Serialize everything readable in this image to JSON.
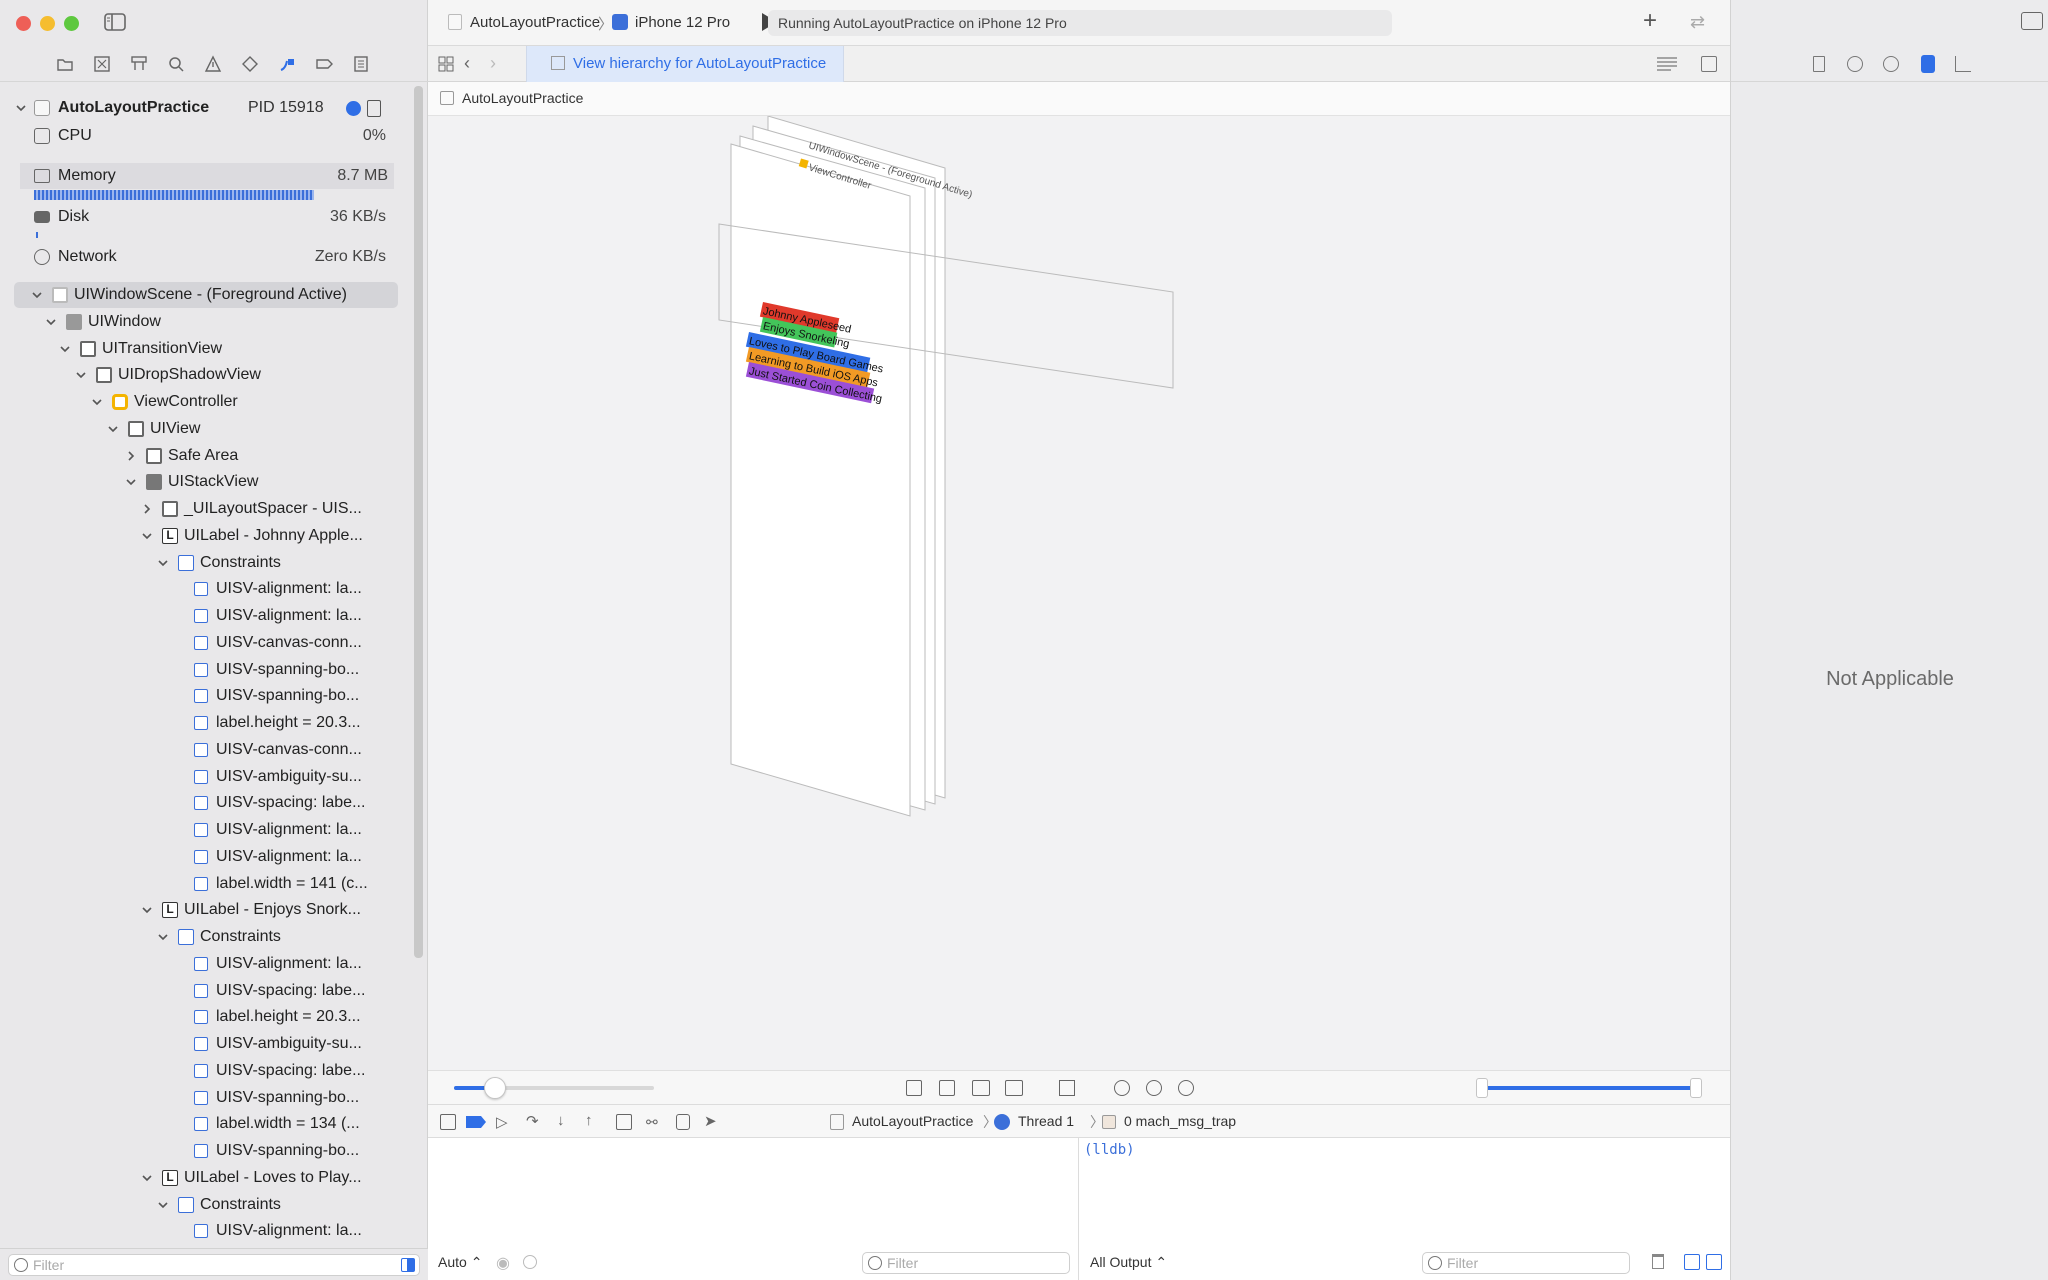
{
  "toolbar": {
    "scheme": "AutoLayoutPractice",
    "device": "iPhone 12 Pro",
    "status": "Running AutoLayoutPractice on iPhone 12 Pro"
  },
  "tab": {
    "title": "View hierarchy for AutoLayoutPractice"
  },
  "breadcrumb": {
    "item": "AutoLayoutPractice"
  },
  "process": {
    "name": "AutoLayoutPractice",
    "pid": "PID 15918"
  },
  "gauges": [
    {
      "label": "CPU",
      "value": "0%"
    },
    {
      "label": "Memory",
      "value": "8.7 MB"
    },
    {
      "label": "Disk",
      "value": "36 KB/s"
    },
    {
      "label": "Network",
      "value": "Zero KB/s"
    }
  ],
  "tree": [
    {
      "label": "UIWindowScene - (Foreground Active)"
    },
    {
      "label": "UIWindow"
    },
    {
      "label": "UITransitionView"
    },
    {
      "label": "UIDropShadowView"
    },
    {
      "label": "ViewController"
    },
    {
      "label": "UIView"
    },
    {
      "label": "Safe Area"
    },
    {
      "label": "UIStackView"
    },
    {
      "label": "_UILayoutSpacer - UIS..."
    },
    {
      "label": "UILabel - Johnny Apple..."
    },
    {
      "label": "Constraints"
    },
    {
      "label": "UISV-alignment: la..."
    },
    {
      "label": "UISV-alignment: la..."
    },
    {
      "label": "UISV-canvas-conn..."
    },
    {
      "label": "UISV-spanning-bo..."
    },
    {
      "label": "UISV-spanning-bo..."
    },
    {
      "label": "label.height = 20.3..."
    },
    {
      "label": "UISV-canvas-conn..."
    },
    {
      "label": "UISV-ambiguity-su..."
    },
    {
      "label": "UISV-spacing: labe..."
    },
    {
      "label": "UISV-alignment: la..."
    },
    {
      "label": "UISV-alignment: la..."
    },
    {
      "label": "label.width = 141 (c..."
    },
    {
      "label": "UILabel - Enjoys Snork..."
    },
    {
      "label": "Constraints"
    },
    {
      "label": "UISV-alignment: la..."
    },
    {
      "label": "UISV-spacing: labe..."
    },
    {
      "label": "label.height = 20.3..."
    },
    {
      "label": "UISV-ambiguity-su..."
    },
    {
      "label": "UISV-spacing: labe..."
    },
    {
      "label": "UISV-spanning-bo..."
    },
    {
      "label": "label.width = 134 (..."
    },
    {
      "label": "UISV-spanning-bo..."
    },
    {
      "label": "UILabel - Loves to Play..."
    },
    {
      "label": "Constraints"
    },
    {
      "label": "UISV-alignment: la..."
    }
  ],
  "scene": {
    "scene_label": "UIWindowScene - (Foreground Active)",
    "vc_label": "ViewController",
    "labels": [
      {
        "text": "Johnny Appleseed",
        "color": "#e0392b"
      },
      {
        "text": "Enjoys Snorkeling",
        "color": "#43c55a"
      },
      {
        "text": "Loves to Play Board Games",
        "color": "#2f6ee6"
      },
      {
        "text": "Learning to Build iOS Apps",
        "color": "#f29a25"
      },
      {
        "text": "Just Started Coin Collecting",
        "color": "#9b4fd6"
      }
    ]
  },
  "debugbar": {
    "target": "AutoLayoutPractice",
    "thread": "Thread 1",
    "frame": "0 mach_msg_trap"
  },
  "console": {
    "prompt": "(lldb)",
    "auto_label": "Auto ⌃",
    "output_label": "All Output ⌃",
    "filter_placeholder": "Filter"
  },
  "left_filter": {
    "placeholder": "Filter"
  },
  "inspector": {
    "empty": "Not Applicable"
  },
  "colors": {
    "accent": "#2f6ee6",
    "selected_tab": "#dde8fa"
  }
}
